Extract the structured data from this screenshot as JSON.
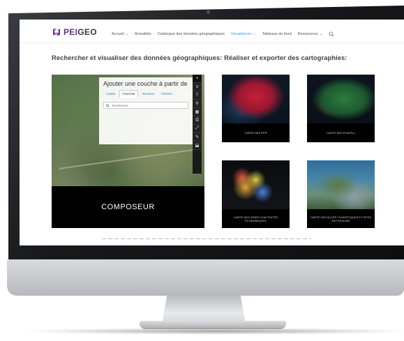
{
  "site": {
    "logo_brand_prefix": "PEI",
    "logo_brand_suffix": "GEO",
    "brand_color": "#6a2d8f",
    "link_color": "#2ea3f2"
  },
  "nav": {
    "items": [
      {
        "label": "Accueil",
        "has_dropdown": true,
        "active": false
      },
      {
        "label": "Actualités",
        "has_dropdown": false,
        "active": false
      },
      {
        "label": "Catalogue des données géographiques",
        "has_dropdown": false,
        "active": false
      },
      {
        "label": "Visualiseurs",
        "has_dropdown": true,
        "active": true
      },
      {
        "label": "Tableaux de bord",
        "has_dropdown": false,
        "active": false
      },
      {
        "label": "Ressources",
        "has_dropdown": true,
        "active": false
      }
    ],
    "dropdown_glyph": "⌄",
    "search_icon": "search-icon"
  },
  "page": {
    "title": "Rechercher et visualiser des données géographiques: Réaliser et exporter des cartographies:"
  },
  "composer": {
    "label": "COMPOSEUR",
    "panel_title": "Ajouter une couche à partir de",
    "tabs": [
      {
        "label": "Cartes",
        "active": false
      },
      {
        "label": "Chercher",
        "active": true
      },
      {
        "label": "Services",
        "active": false
      },
      {
        "label": "Fichiers",
        "active": false
      }
    ],
    "search_placeholder": "Rechercher",
    "tools": [
      "+",
      "≡",
      "⊤",
      "⚲",
      "▦",
      "⎙",
      "⤢",
      "✎",
      "⬓"
    ]
  },
  "cards": [
    {
      "caption": "CARTE DES PPR"
    },
    {
      "caption": "CARTE DES POS/PLU"
    },
    {
      "caption": "CARTE DES ZONES D'ACTIVITÉS ÉCONOMIQUES"
    },
    {
      "caption": "CARTE DES ACCÈS TOURISTIQUES ET SITES DE PLEIN AIR"
    }
  ]
}
